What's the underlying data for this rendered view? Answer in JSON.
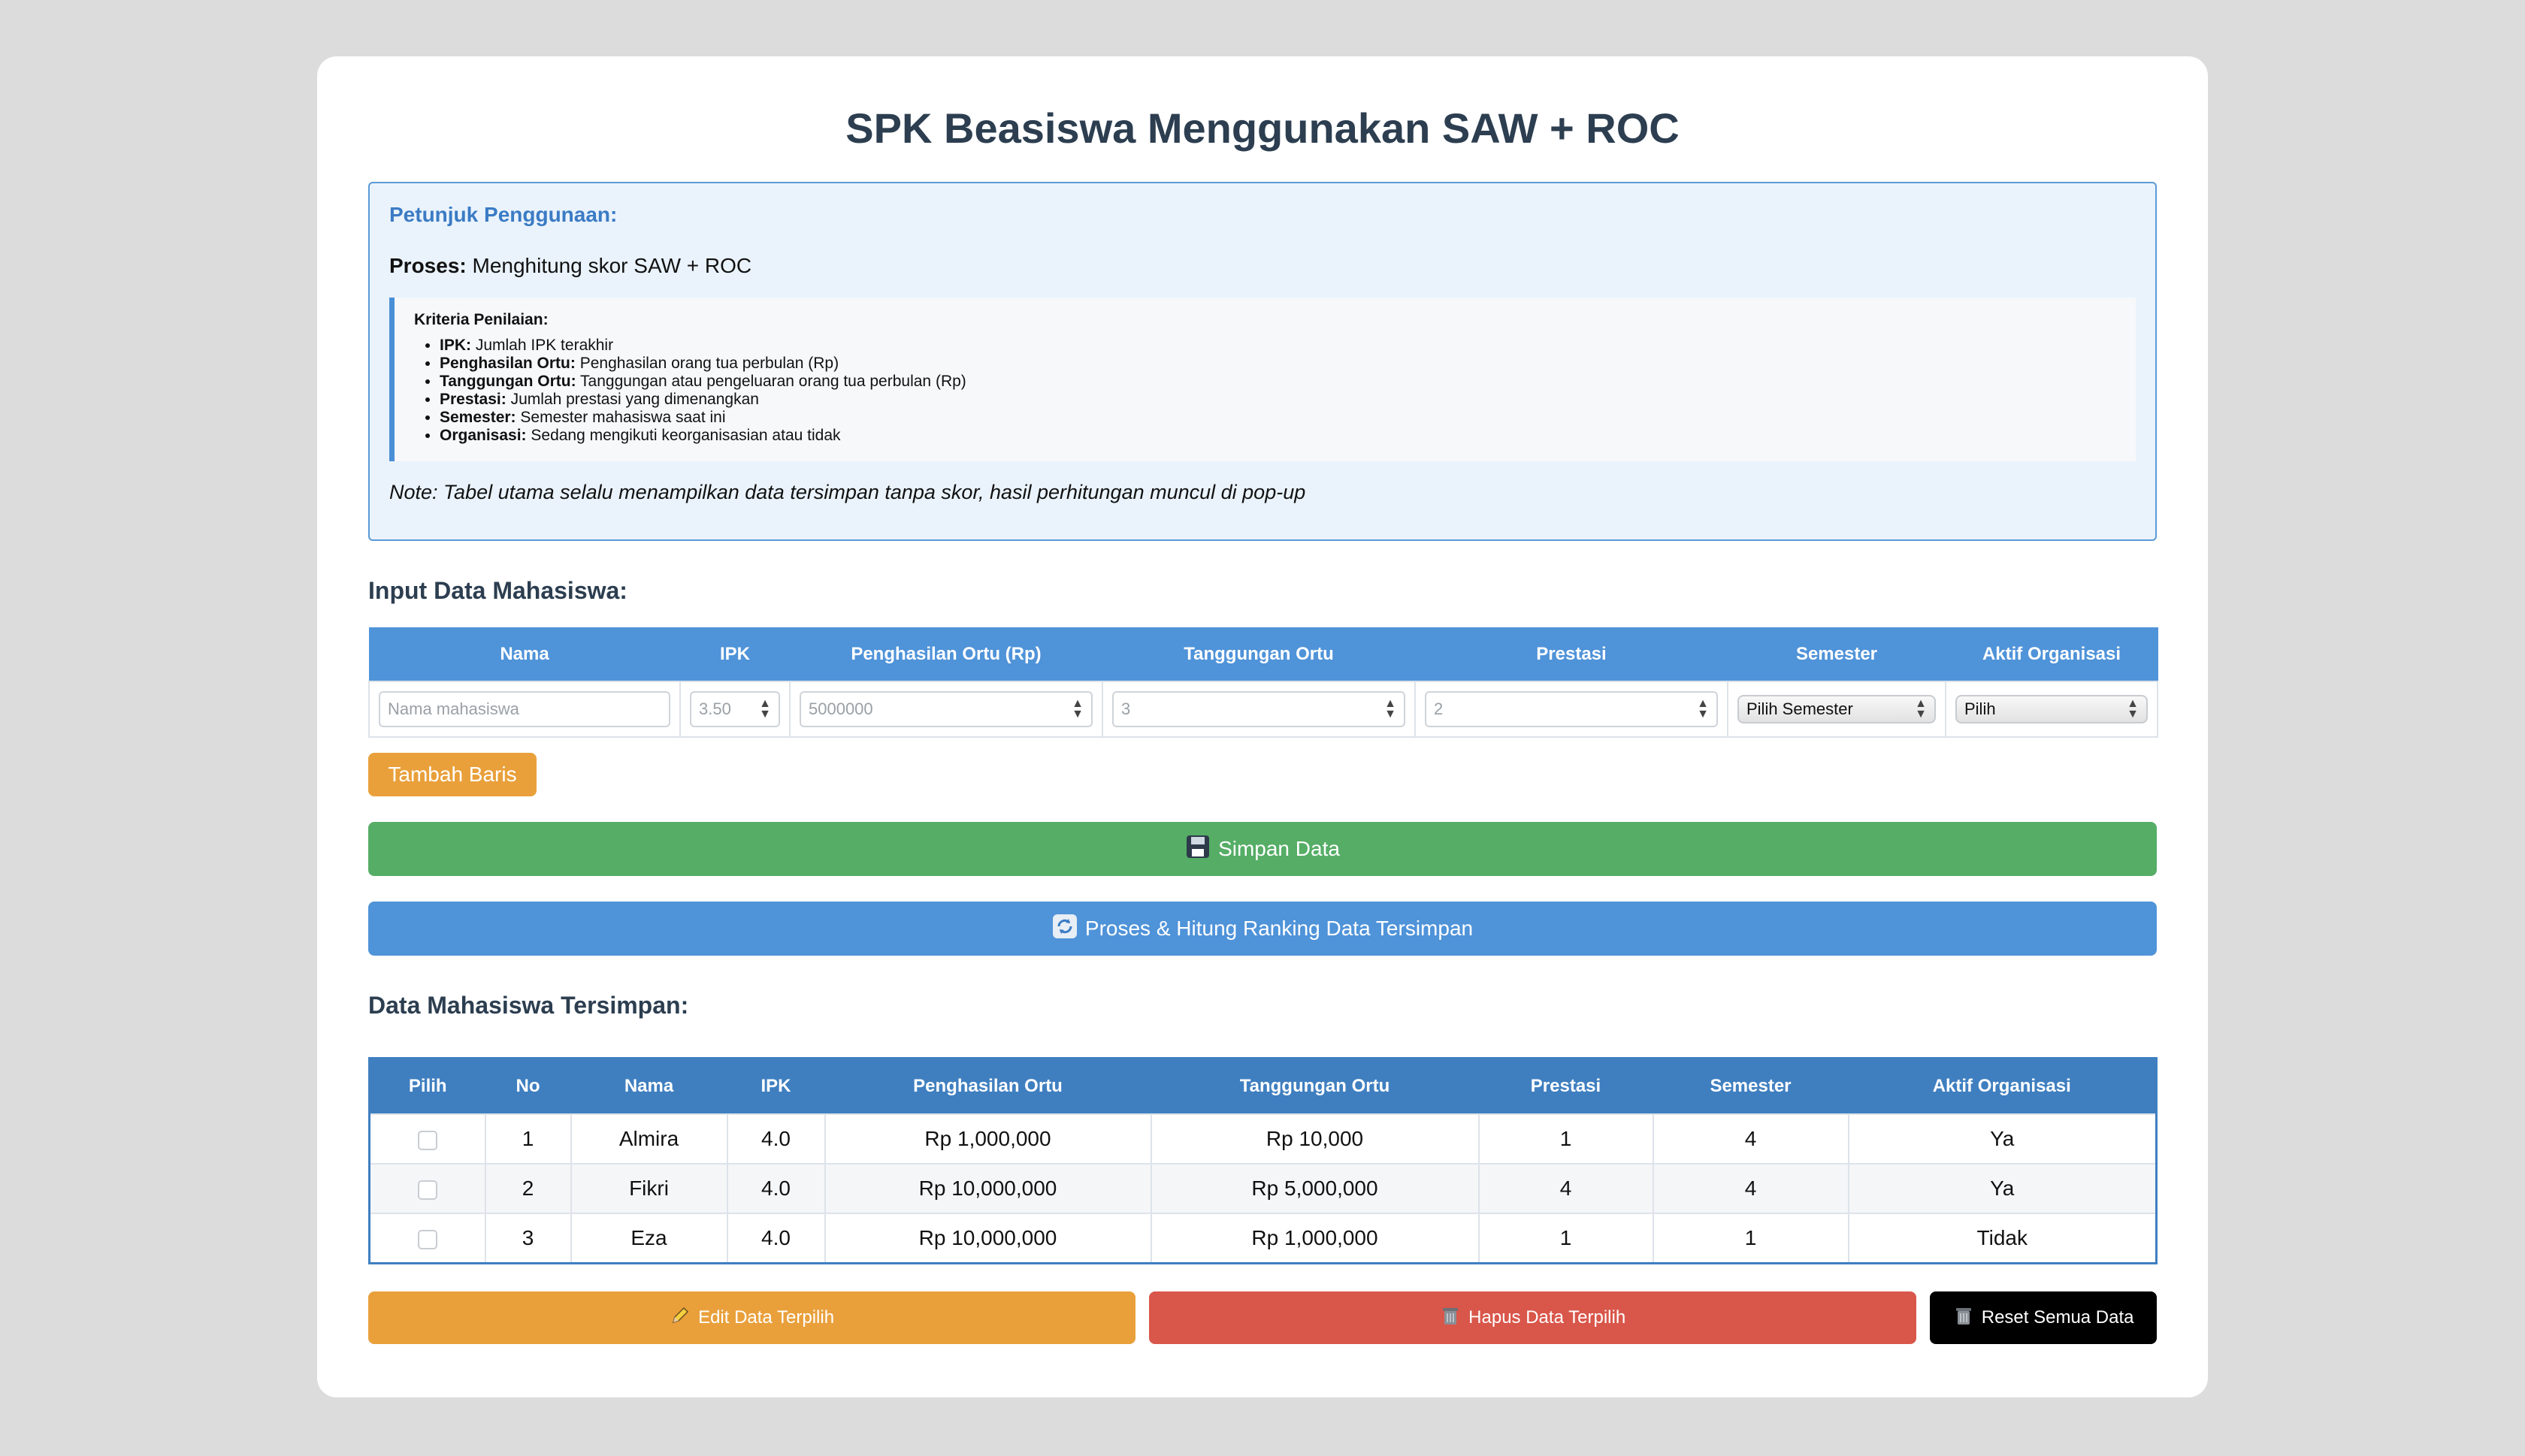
{
  "title": "SPK Beasiswa Menggunakan SAW + ROC",
  "instructions": {
    "heading": "Petunjuk Penggunaan:",
    "process_label": "Proses:",
    "process_text": "Menghitung skor SAW + ROC",
    "criteria_title": "Kriteria Penilaian:",
    "criteria": [
      {
        "name": "IPK:",
        "desc": "Jumlah IPK terakhir"
      },
      {
        "name": "Penghasilan Ortu:",
        "desc": "Penghasilan orang tua perbulan (Rp)"
      },
      {
        "name": "Tanggungan Ortu:",
        "desc": "Tanggungan atau pengeluaran orang tua perbulan (Rp)"
      },
      {
        "name": "Prestasi:",
        "desc": "Jumlah prestasi yang dimenangkan"
      },
      {
        "name": "Semester:",
        "desc": "Semester mahasiswa saat ini"
      },
      {
        "name": "Organisasi:",
        "desc": "Sedang mengikuti keorganisasian atau tidak"
      }
    ],
    "note": "Note: Tabel utama selalu menampilkan data tersimpan tanpa skor, hasil perhitungan muncul di pop-up"
  },
  "input": {
    "section_title": "Input Data Mahasiswa:",
    "headers": [
      "Nama",
      "IPK",
      "Penghasilan Ortu (Rp)",
      "Tanggungan Ortu",
      "Prestasi",
      "Semester",
      "Aktif Organisasi"
    ],
    "nama_placeholder": "Nama mahasiswa",
    "ipk_placeholder": "3.50",
    "penghasilan_placeholder": "5000000",
    "tanggungan_placeholder": "3",
    "prestasi_placeholder": "2",
    "semester_selected": "Pilih Semester",
    "organisasi_selected": "Pilih",
    "add_row_label": "Tambah Baris",
    "save_label": "Simpan Data",
    "save_icon": "floppy-disk-icon",
    "process_label": "Proses & Hitung Ranking Data Tersimpan",
    "process_icon": "refresh-icon"
  },
  "stored": {
    "section_title": "Data Mahasiswa Tersimpan:",
    "headers": [
      "Pilih",
      "No",
      "Nama",
      "IPK",
      "Penghasilan Ortu",
      "Tanggungan Ortu",
      "Prestasi",
      "Semester",
      "Aktif Organisasi"
    ],
    "rows": [
      {
        "no": "1",
        "nama": "Almira",
        "ipk": "4.0",
        "penghasilan": "Rp 1,000,000",
        "tanggungan": "Rp 10,000",
        "prestasi": "1",
        "semester": "4",
        "organisasi": "Ya"
      },
      {
        "no": "2",
        "nama": "Fikri",
        "ipk": "4.0",
        "penghasilan": "Rp 10,000,000",
        "tanggungan": "Rp 5,000,000",
        "prestasi": "4",
        "semester": "4",
        "organisasi": "Ya"
      },
      {
        "no": "3",
        "nama": "Eza",
        "ipk": "4.0",
        "penghasilan": "Rp 10,000,000",
        "tanggungan": "Rp 1,000,000",
        "prestasi": "1",
        "semester": "1",
        "organisasi": "Tidak"
      }
    ]
  },
  "actions": {
    "edit_label": "Edit Data Terpilih",
    "delete_label": "Hapus Data Terpilih",
    "reset_label": "Reset Semua Data"
  },
  "colors": {
    "primary": "#4f93d9",
    "table_header": "#3f7fc0",
    "success": "#55ad66",
    "warning": "#e9a03b",
    "danger": "#d9564a",
    "dark": "#000000",
    "title": "#2c3e50"
  }
}
